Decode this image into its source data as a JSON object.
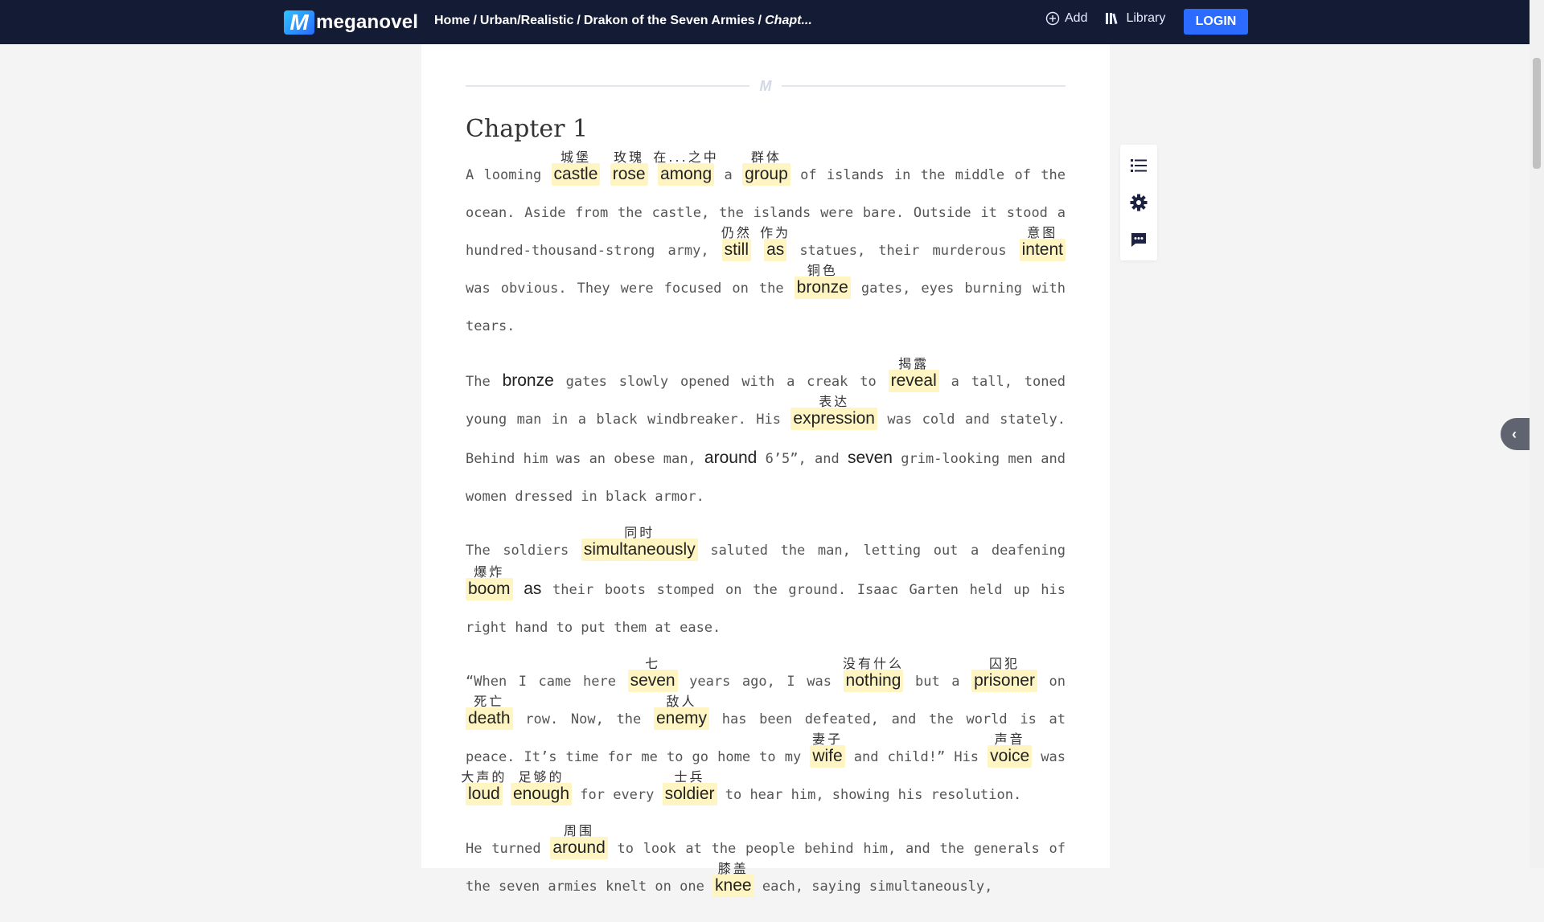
{
  "header": {
    "logo_text": "meganovel",
    "breadcrumb": {
      "home": "Home",
      "category": "Urban/Realistic",
      "book": "Drakon of the Seven Armies",
      "current": "Chapt..."
    },
    "add_label": "Add",
    "library_label": "Library",
    "login_label": "LOGIN"
  },
  "divider_mark": "M",
  "chapter": {
    "title": "Chapter 1",
    "paragraphs": [
      [
        {
          "t": "A looming "
        },
        {
          "w": "castle",
          "g": "城堡"
        },
        {
          "t": " "
        },
        {
          "w": "rose",
          "g": "玫瑰"
        },
        {
          "t": " "
        },
        {
          "w": "among",
          "g": "在...之中"
        },
        {
          "t": " a "
        },
        {
          "w": "group",
          "g": "群体"
        },
        {
          "t": " of islands in the middle of the ocean. Aside from the castle, the islands were bare. Outside it stood a hundred-thousand-strong army, "
        },
        {
          "w": "still",
          "g": "仍然"
        },
        {
          "t": " "
        },
        {
          "w": "as",
          "g": "作为"
        },
        {
          "t": " statues, their murderous "
        },
        {
          "w": "intent",
          "g": "意图"
        },
        {
          "t": " was obvious. They were focused on the "
        },
        {
          "w": "bronze",
          "g": "铜色"
        },
        {
          "t": " gates, eyes burning with tears."
        }
      ],
      [
        {
          "t": "The "
        },
        {
          "b": "bronze"
        },
        {
          "t": " gates slowly opened with a creak to "
        },
        {
          "w": "reveal",
          "g": "揭露"
        },
        {
          "t": " a tall, toned young man in a black windbreaker. His "
        },
        {
          "w": "expression",
          "g": "表达"
        },
        {
          "t": " was cold and stately. Behind him was an obese man, "
        },
        {
          "b": "around"
        },
        {
          "t": " 6’5”, and "
        },
        {
          "b": "seven"
        },
        {
          "t": " grim-looking men and women dressed in black armor."
        }
      ],
      [
        {
          "t": "The soldiers "
        },
        {
          "w": "simultaneously",
          "g": "同时"
        },
        {
          "t": " saluted the man, letting out a deafening "
        },
        {
          "w": "boom",
          "g": "爆炸"
        },
        {
          "t": " "
        },
        {
          "b": "as"
        },
        {
          "t": " their boots stomped on the ground. Isaac Garten held up his right hand to put them at ease."
        }
      ],
      [
        {
          "t": "“When I came here "
        },
        {
          "w": "seven",
          "g": "七"
        },
        {
          "t": " years ago, I was "
        },
        {
          "w": "nothing",
          "g": "没有什么"
        },
        {
          "t": " but a "
        },
        {
          "w": "prisoner",
          "g": "囚犯"
        },
        {
          "t": " on "
        },
        {
          "w": "death",
          "g": "死亡"
        },
        {
          "t": " row. Now, the "
        },
        {
          "w": "enemy",
          "g": "敌人"
        },
        {
          "t": " has been defeated, and the world is at peace. It’s time for me to go home to my "
        },
        {
          "w": "wife",
          "g": "妻子"
        },
        {
          "t": " and child!” His "
        },
        {
          "w": "voice",
          "g": "声音"
        },
        {
          "t": " was "
        },
        {
          "w": "loud",
          "g": "大声的"
        },
        {
          "t": " "
        },
        {
          "w": "enough",
          "g": "足够的"
        },
        {
          "t": " for every "
        },
        {
          "w": "soldier",
          "g": "士兵"
        },
        {
          "t": " to hear him, showing his resolution."
        }
      ],
      [
        {
          "t": "He turned "
        },
        {
          "w": "around",
          "g": "周围"
        },
        {
          "t": " to look at the people behind him, and the generals of the seven armies knelt on one "
        },
        {
          "w": "knee",
          "g": "膝盖"
        },
        {
          "t": " each, saying simultaneously,"
        }
      ]
    ]
  },
  "tools": [
    "list-icon",
    "gear-icon",
    "comment-icon"
  ],
  "colors": {
    "nav_bg": "#141b35",
    "login_bg": "#2b6bff",
    "highlight": "#fff5c2",
    "page_bg": "#f4f4f4"
  }
}
